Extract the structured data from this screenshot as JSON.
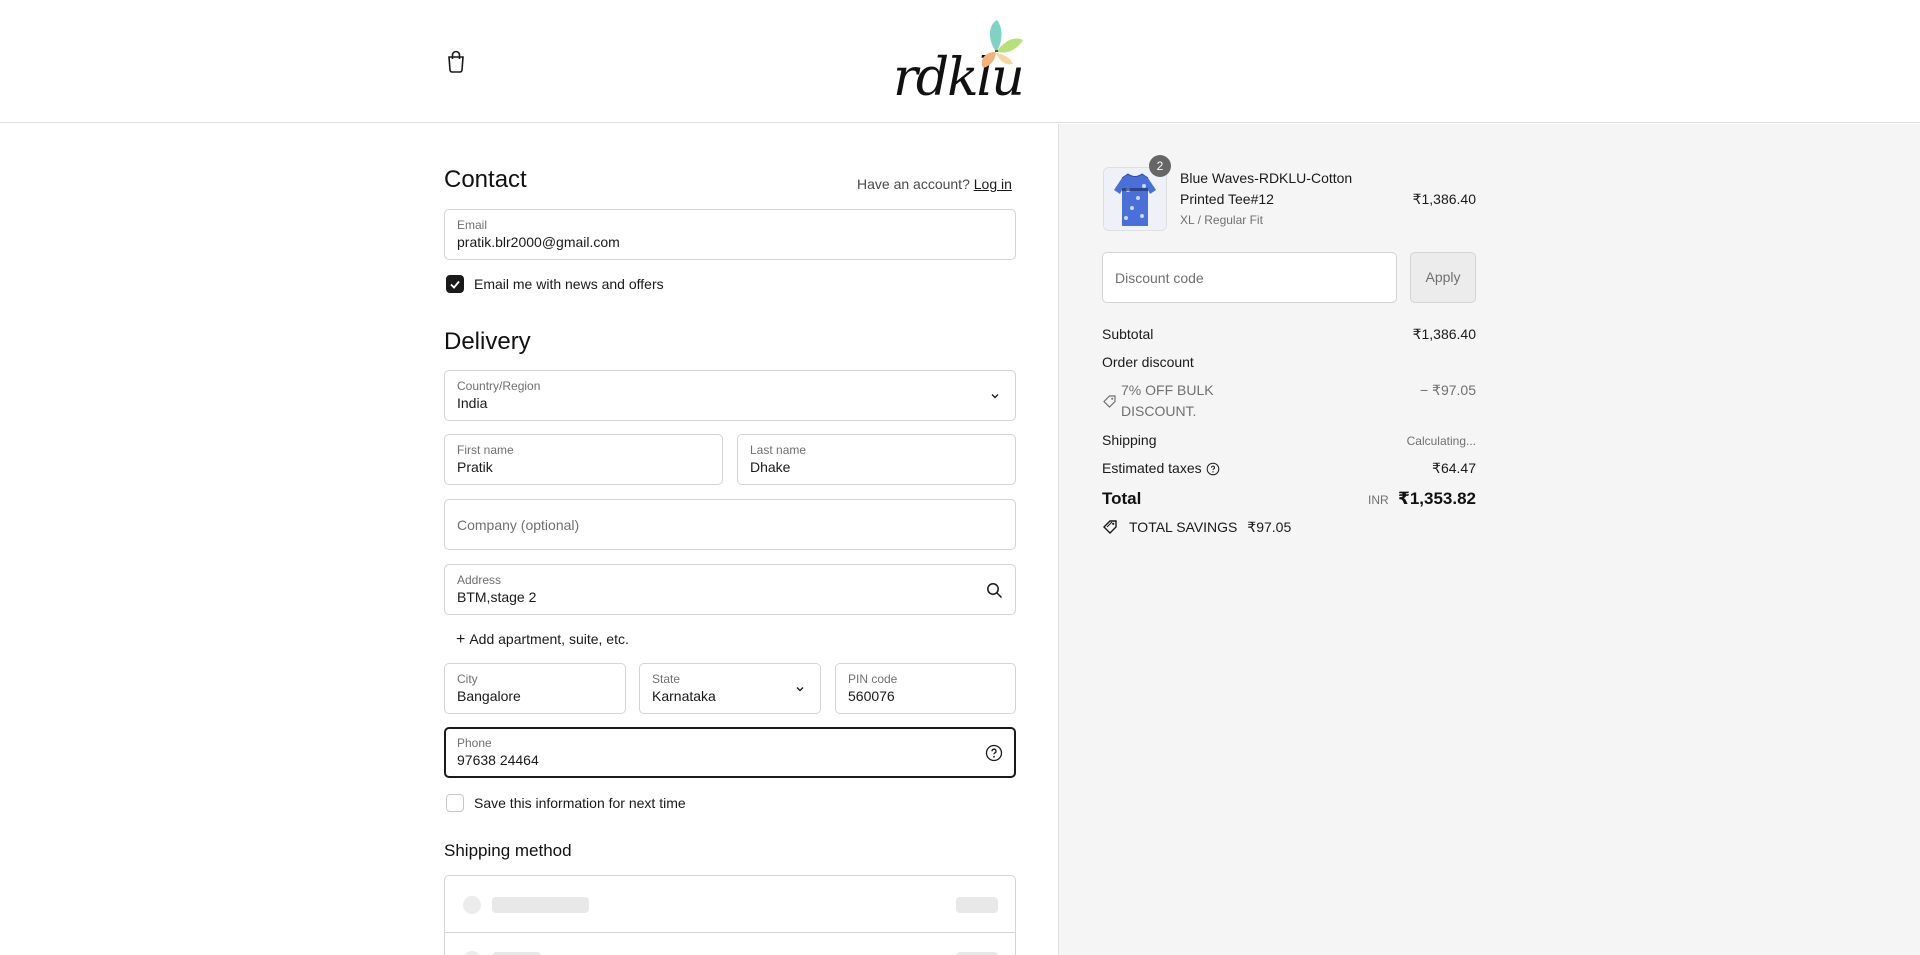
{
  "header": {
    "logo_text": "rdklu"
  },
  "contact": {
    "title": "Contact",
    "have_account": "Have an account?",
    "login_link": "Log in",
    "email_label": "Email",
    "email_value": "pratik.blr2000@gmail.com",
    "news_label": "Email me with news and offers",
    "news_checked": true
  },
  "delivery": {
    "title": "Delivery",
    "country_label": "Country/Region",
    "country_value": "India",
    "first_name_label": "First name",
    "first_name_value": "Pratik",
    "last_name_label": "Last name",
    "last_name_value": "Dhake",
    "company_placeholder": "Company (optional)",
    "address_label": "Address",
    "address_value": "BTM,stage 2",
    "add_apartment": "Add apartment, suite, etc.",
    "city_label": "City",
    "city_value": "Bangalore",
    "state_label": "State",
    "state_value": "Karnataka",
    "pin_label": "PIN code",
    "pin_value": "560076",
    "phone_label": "Phone",
    "phone_value": "97638 24464",
    "save_info_label": "Save this information for next time",
    "save_info_checked": false
  },
  "shipping": {
    "title": "Shipping method"
  },
  "summary": {
    "item_quantity": "2",
    "item_name_line1": "Blue Waves-RDKLU-Cotton",
    "item_name_line2": "Printed Tee#12",
    "item_variant": "XL / Regular Fit",
    "item_price": "₹1,386.40",
    "discount_placeholder": "Discount code",
    "apply_label": "Apply",
    "subtotal_label": "Subtotal",
    "subtotal_value": "₹1,386.40",
    "order_discount_label": "Order discount",
    "discount_line1": "7% OFF BULK",
    "discount_line2": "DISCOUNT.",
    "discount_value": "− ₹97.05",
    "shipping_label": "Shipping",
    "shipping_value": "Calculating...",
    "taxes_label": "Estimated taxes",
    "taxes_value": "₹64.47",
    "total_label": "Total",
    "currency": "INR",
    "total_value": "₹1,353.82",
    "savings_label": "TOTAL SAVINGS",
    "savings_value": "₹97.05"
  },
  "colors": {
    "accent": "#1a1a1a",
    "panel_bg": "#f5f5f5",
    "border": "#d4d4d4",
    "muted": "#707070"
  }
}
